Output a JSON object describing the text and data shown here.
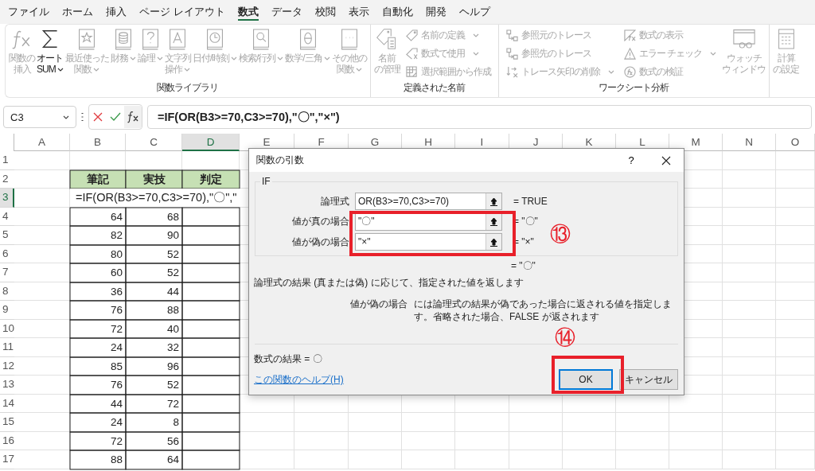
{
  "tabs": [
    {
      "label": "ファイル",
      "selected": false
    },
    {
      "label": "ホーム",
      "selected": false
    },
    {
      "label": "挿入",
      "selected": false
    },
    {
      "label": "ページ レイアウト",
      "selected": false
    },
    {
      "label": "数式",
      "selected": true
    },
    {
      "label": "データ",
      "selected": false
    },
    {
      "label": "校閲",
      "selected": false
    },
    {
      "label": "表示",
      "selected": false
    },
    {
      "label": "自動化",
      "selected": false
    },
    {
      "label": "開発",
      "selected": false
    },
    {
      "label": "ヘルプ",
      "selected": false
    }
  ],
  "ribbon": {
    "groups": [
      {
        "label": "関数ライブラリ",
        "items": [
          {
            "lines": [
              "関数の",
              "挿入"
            ],
            "kind": "large",
            "disabled": true,
            "dropdown": false
          },
          {
            "lines": [
              "オート",
              "SUM"
            ],
            "kind": "large",
            "disabled": false,
            "dropdown": true
          },
          {
            "lines": [
              "最近使った",
              "関数"
            ],
            "kind": "large",
            "disabled": true,
            "dropdown": true
          },
          {
            "lines": [
              "財務"
            ],
            "kind": "large",
            "disabled": true,
            "dropdown": true
          },
          {
            "lines": [
              "論理"
            ],
            "kind": "large",
            "disabled": true,
            "dropdown": true
          },
          {
            "lines": [
              "文字列",
              "操作"
            ],
            "kind": "large",
            "disabled": true,
            "dropdown": true
          },
          {
            "lines": [
              "日付/時刻"
            ],
            "kind": "large",
            "disabled": true,
            "dropdown": true
          },
          {
            "lines": [
              "検索/行列"
            ],
            "kind": "large",
            "disabled": true,
            "dropdown": true
          },
          {
            "lines": [
              "数学/三角"
            ],
            "kind": "large",
            "disabled": true,
            "dropdown": true
          },
          {
            "lines": [
              "その他の",
              "関数"
            ],
            "kind": "large",
            "disabled": true,
            "dropdown": true
          }
        ]
      },
      {
        "label": "定義された名前",
        "items": [
          {
            "lines": [
              "名前",
              "の管理"
            ],
            "kind": "large",
            "disabled": true,
            "dropdown": false
          },
          {
            "lines": [
              "名前の定義"
            ],
            "kind": "small",
            "disabled": true,
            "dropdown": true
          },
          {
            "lines": [
              "数式で使用"
            ],
            "kind": "small",
            "disabled": true,
            "dropdown": true
          },
          {
            "lines": [
              "選択範囲から作成"
            ],
            "kind": "small",
            "disabled": true,
            "dropdown": false
          }
        ]
      },
      {
        "label": "ワークシート分析",
        "items": [
          {
            "lines": [
              "参照元のトレース"
            ],
            "kind": "small",
            "disabled": true,
            "dropdown": false
          },
          {
            "lines": [
              "参照先のトレース"
            ],
            "kind": "small",
            "disabled": true,
            "dropdown": false
          },
          {
            "lines": [
              "トレース矢印の削除"
            ],
            "kind": "small",
            "disabled": true,
            "dropdown": true
          },
          {
            "lines": [
              "数式の表示"
            ],
            "kind": "small",
            "disabled": true,
            "dropdown": false
          },
          {
            "lines": [
              "エラー チェック"
            ],
            "kind": "small",
            "disabled": true,
            "dropdown": true
          },
          {
            "lines": [
              "数式の検証"
            ],
            "kind": "small",
            "disabled": true,
            "dropdown": false
          },
          {
            "lines": [
              "ウォッチ",
              "ウィンドウ"
            ],
            "kind": "large",
            "disabled": true,
            "dropdown": false
          }
        ]
      },
      {
        "items": [
          {
            "lines": [
              "計算",
              "の設定"
            ],
            "kind": "large",
            "disabled": true,
            "dropdown": false
          }
        ]
      }
    ]
  },
  "formula_bar": {
    "name_box": "C3",
    "formula": "=IF(OR(B3>=70,C3>=70),\"〇\",\"×\")"
  },
  "sheet": {
    "columns": [
      {
        "label": "A",
        "selected": false
      },
      {
        "label": "B",
        "selected": false
      },
      {
        "label": "C",
        "selected": false
      },
      {
        "label": "D",
        "selected": true
      },
      {
        "label": "E",
        "selected": false
      },
      {
        "label": "F",
        "selected": false
      },
      {
        "label": "G",
        "selected": false
      },
      {
        "label": "H",
        "selected": false
      },
      {
        "label": "I",
        "selected": false
      },
      {
        "label": "J",
        "selected": false
      },
      {
        "label": "K",
        "selected": false
      },
      {
        "label": "L",
        "selected": false
      },
      {
        "label": "M",
        "selected": false
      },
      {
        "label": "N",
        "selected": false
      },
      {
        "label": "O",
        "selected": false
      }
    ],
    "rows": [
      {
        "number": "1",
        "kind": "blank",
        "selected": false
      },
      {
        "number": "2",
        "kind": "header",
        "selected": false,
        "B": "筆記",
        "C": "実技",
        "D": "判定"
      },
      {
        "number": "3",
        "kind": "formula",
        "selected": true,
        "B": "=IF(OR(B3>=70,C3>=70),\"〇\",\""
      },
      {
        "number": "4",
        "kind": "data",
        "selected": false,
        "B": "64",
        "C": "68"
      },
      {
        "number": "5",
        "kind": "data",
        "selected": false,
        "B": "82",
        "C": "90"
      },
      {
        "number": "6",
        "kind": "data",
        "selected": false,
        "B": "80",
        "C": "52"
      },
      {
        "number": "7",
        "kind": "data",
        "selected": false,
        "B": "60",
        "C": "52"
      },
      {
        "number": "8",
        "kind": "data",
        "selected": false,
        "B": "36",
        "C": "44"
      },
      {
        "number": "9",
        "kind": "data",
        "selected": false,
        "B": "76",
        "C": "88"
      },
      {
        "number": "10",
        "kind": "data",
        "selected": false,
        "B": "72",
        "C": "40"
      },
      {
        "number": "11",
        "kind": "data",
        "selected": false,
        "B": "24",
        "C": "32"
      },
      {
        "number": "12",
        "kind": "data",
        "selected": false,
        "B": "85",
        "C": "96"
      },
      {
        "number": "13",
        "kind": "data",
        "selected": false,
        "B": "76",
        "C": "52"
      },
      {
        "number": "14",
        "kind": "data",
        "selected": false,
        "B": "44",
        "C": "72"
      },
      {
        "number": "15",
        "kind": "data",
        "selected": false,
        "B": "24",
        "C": "8"
      },
      {
        "number": "16",
        "kind": "data",
        "selected": false,
        "B": "72",
        "C": "56"
      },
      {
        "number": "17",
        "kind": "data",
        "selected": false,
        "B": "88",
        "C": "64"
      }
    ]
  },
  "dialog": {
    "title": "関数の引数",
    "help": "?",
    "function": "IF",
    "arguments": [
      {
        "label": "論理式",
        "value": "OR(B3>=70,C3>=70)",
        "result": "= TRUE"
      },
      {
        "label": "値が真の場合",
        "value": "\"〇\"",
        "result": "= \"〇\""
      },
      {
        "label": "値が偽の場合",
        "value": "\"×\"",
        "result": "= \"×\""
      }
    ],
    "result": "= \"〇\"",
    "description": "論理式の結果 (真または偽) に応じて、指定された値を返します",
    "argument_help": {
      "label": "値が偽の場合",
      "text": "には論理式の結果が偽であった場合に返される値を指定します。省略された場合、FALSE が返されます"
    },
    "formula_result": "数式の結果 = 〇",
    "help_link": "この関数のヘルプ(H)",
    "buttons": [
      {
        "label": "OK",
        "default": true
      },
      {
        "label": "キャンセル",
        "default": false
      }
    ]
  },
  "annotations": [
    {
      "label": "⑬"
    },
    {
      "label": "⑭"
    }
  ]
}
